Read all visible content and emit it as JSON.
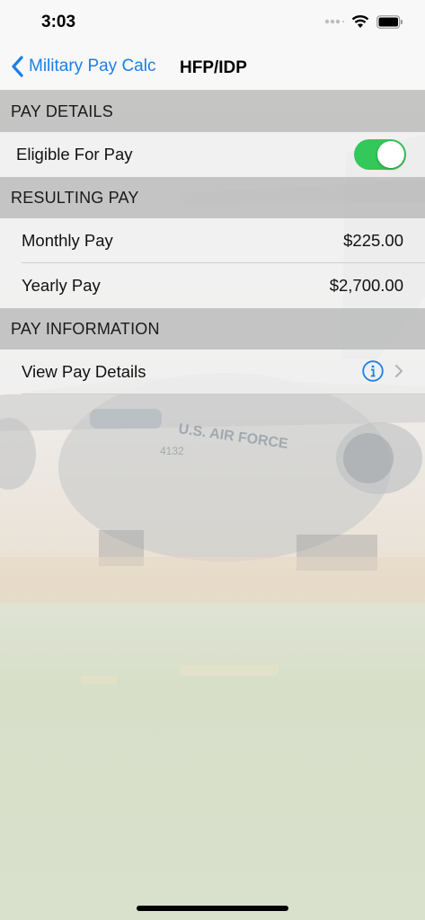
{
  "status_bar": {
    "time": "3:03"
  },
  "nav": {
    "back_label": "Military Pay Calc",
    "title": "HFP/IDP"
  },
  "sections": {
    "pay_details": {
      "header": "PAY DETAILS",
      "eligible_label": "Eligible For Pay",
      "eligible_on": true
    },
    "resulting_pay": {
      "header": "RESULTING PAY",
      "monthly_label": "Monthly Pay",
      "monthly_value": "$225.00",
      "yearly_label": "Yearly Pay",
      "yearly_value": "$2,700.00"
    },
    "pay_information": {
      "header": "PAY INFORMATION",
      "details_label": "View Pay Details"
    }
  },
  "background": {
    "aircraft_marking": "U.S. AIR FORCE",
    "tail_number": "4132"
  },
  "colors": {
    "accent": "#1a7fe8",
    "toggle_on": "#34c759",
    "section_header": "#c0c0c0"
  },
  "icons": [
    "back-chevron-icon",
    "wifi-icon",
    "battery-icon",
    "signal-icon",
    "info-icon",
    "chevron-right-icon"
  ]
}
